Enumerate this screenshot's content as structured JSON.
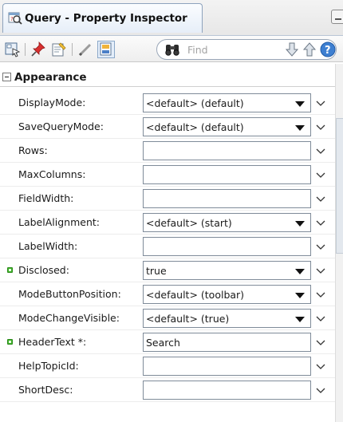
{
  "window": {
    "title": "Query - Property Inspector"
  },
  "toolbar": {
    "search_placeholder": "Find",
    "icons": [
      "select-icon",
      "pin-icon",
      "edit-source-icon",
      "pencil-icon",
      "bind-icon",
      "binoculars-icon",
      "arrow-down-icon",
      "arrow-up-icon",
      "help-icon"
    ]
  },
  "section": {
    "title": "Appearance"
  },
  "properties": [
    {
      "label": "DisplayMode:",
      "value": "<default> (default)",
      "type": "select",
      "set": false
    },
    {
      "label": "SaveQueryMode:",
      "value": "<default> (default)",
      "type": "select",
      "set": false
    },
    {
      "label": "Rows:",
      "value": "",
      "type": "text",
      "set": false
    },
    {
      "label": "MaxColumns:",
      "value": "",
      "type": "text",
      "set": false
    },
    {
      "label": "FieldWidth:",
      "value": "",
      "type": "text",
      "set": false
    },
    {
      "label": "LabelAlignment:",
      "value": "<default> (start)",
      "type": "select",
      "set": false
    },
    {
      "label": "LabelWidth:",
      "value": "",
      "type": "text",
      "set": false
    },
    {
      "label": "Disclosed:",
      "value": "true",
      "type": "select",
      "set": true
    },
    {
      "label": "ModeButtonPosition:",
      "value": "<default> (toolbar)",
      "type": "select",
      "set": false
    },
    {
      "label": "ModeChangeVisible:",
      "value": "<default> (true)",
      "type": "select",
      "set": false
    },
    {
      "label": "HeaderText *:",
      "value": "Search",
      "type": "text",
      "set": true
    },
    {
      "label": "HelpTopicId:",
      "value": "",
      "type": "text",
      "set": false
    },
    {
      "label": "ShortDesc:",
      "value": "",
      "type": "text",
      "set": false
    }
  ],
  "colors": {
    "set_marker": "#3fb42a",
    "tab_border": "#8ea3bd",
    "accent": "#3d7fd1"
  }
}
